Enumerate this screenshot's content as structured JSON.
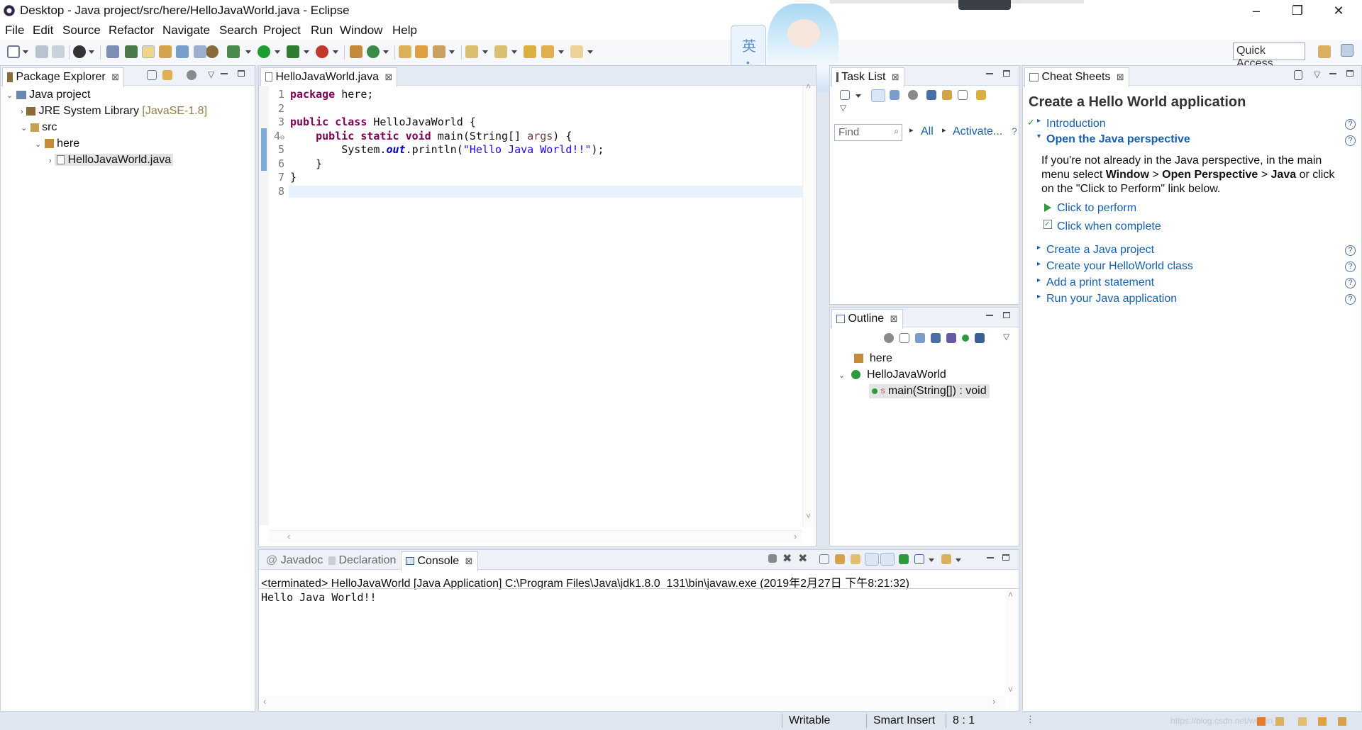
{
  "window": {
    "title": "Desktop - Java project/src/here/HelloJavaWorld.java - Eclipse",
    "minimize": "–",
    "restore": "❐",
    "close": "✕"
  },
  "menu": [
    "File",
    "Edit",
    "Source",
    "Refactor",
    "Navigate",
    "Search",
    "Project",
    "Run",
    "Window",
    "Help"
  ],
  "toolbar": {
    "quick_access": "Quick Access"
  },
  "ime": {
    "char": "英"
  },
  "package_explorer": {
    "tab": "Package Explorer",
    "project": "Java project",
    "jre_label": "JRE System Library",
    "jre_version": "[JavaSE-1.8]",
    "src": "src",
    "package": "here",
    "file": "HelloJavaWorld.java"
  },
  "editor": {
    "tab": "HelloJavaWorld.java",
    "line_numbers": [
      "1",
      "2",
      "3",
      "4",
      "5",
      "6",
      "7",
      "8"
    ],
    "lines": {
      "l1_kw": "package",
      "l1_rest": " here;",
      "l3_kw1": "public",
      "l3_kw2": "class",
      "l3_rest": " HelloJavaWorld {",
      "l4_kw1": "public",
      "l4_kw2": "static",
      "l4_kw3": "void",
      "l4_a": " main(String[] ",
      "l4_param": "args",
      "l4_b": ") {",
      "l5_a": "System.",
      "l5_field": "out",
      "l5_b": ".println(",
      "l5_str": "\"Hello Java World!!\"",
      "l5_c": ");",
      "l6": "}",
      "l7": "}"
    }
  },
  "task_list": {
    "tab": "Task List",
    "find_placeholder": "Find",
    "all": "All",
    "activate": "Activate..."
  },
  "outline": {
    "tab": "Outline",
    "package": "here",
    "class": "HelloJavaWorld",
    "method": "main(String[]) : void"
  },
  "cheat_sheets": {
    "tab": "Cheat Sheets",
    "title": "Create a Hello World application",
    "intro": "Introduction",
    "open_perspective": "Open the Java perspective",
    "desc_1": "If you're not already in the Java perspective, in the main",
    "desc_2a": "menu select ",
    "desc_window": "Window",
    "desc_gt1": " > ",
    "desc_open": "Open Perspective",
    "desc_gt2": " > ",
    "desc_java": "Java",
    "desc_2b": " or click",
    "desc_3": "on the \"Click to Perform\" link below.",
    "click_perform": "Click to perform",
    "click_complete": "Click when complete",
    "steps": [
      "Create a Java project",
      "Create your HelloWorld class",
      "Add a print statement",
      "Run your Java application"
    ]
  },
  "console_area": {
    "tabs": [
      "Javadoc",
      "Declaration",
      "Console"
    ],
    "terminated": "<terminated> HelloJavaWorld [Java Application] C:\\Program Files\\Java\\jdk1.8.0_131\\bin\\javaw.exe (2019年2月27日 下午8:21:32)",
    "output": "Hello Java World!!"
  },
  "status": {
    "writable": "Writable",
    "insert": "Smart Insert",
    "position": "8 : 1",
    "watermark": "https://blog.csdn.net/weixin_..."
  },
  "colors": {
    "keyword": "#7f0055",
    "string": "#2a00ff",
    "link": "#1560b0"
  }
}
